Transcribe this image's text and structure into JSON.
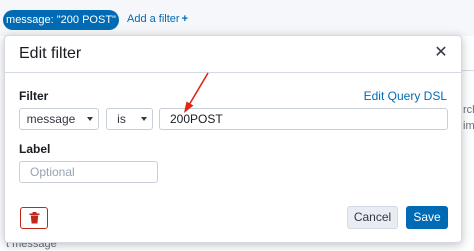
{
  "filter_bar": {
    "pill_label": "message: \"200 POST\"",
    "add_filter_label": "Add a filter",
    "add_filter_plus": "+"
  },
  "background": {
    "right_fragment_1": "rch",
    "right_fragment_2": "ime",
    "bottom_fragment": "t  message"
  },
  "modal": {
    "title": "Edit filter",
    "close_glyph": "✕",
    "filter_label": "Filter",
    "query_dsl_link": "Edit Query DSL",
    "field_select_value": "message",
    "operator_select_value": "is",
    "value_input": "200POST",
    "label_label": "Label",
    "label_placeholder": "Optional",
    "cancel_label": "Cancel",
    "save_label": "Save"
  },
  "colors": {
    "primary": "#006bb4",
    "danger": "#bd271e",
    "annotation_arrow": "#e0261b"
  },
  "icons": {
    "close": "close-icon",
    "delete": "trash-icon",
    "caret": "chevron-down-icon",
    "add": "plus-icon"
  }
}
